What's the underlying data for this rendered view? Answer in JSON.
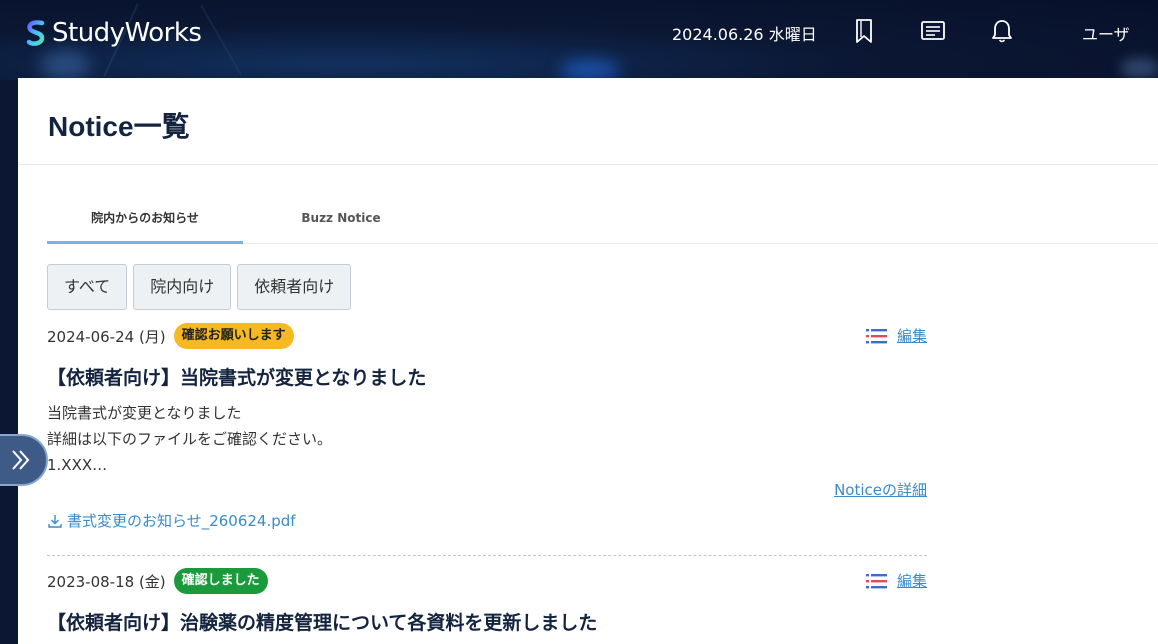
{
  "header": {
    "logo_text": "StudyWorks",
    "date": "2024.06.26 水曜日",
    "icons": [
      "bookmark-icon",
      "message-icon",
      "bell-icon"
    ],
    "user": "ユーザ"
  },
  "page": {
    "title": "Notice一覧"
  },
  "tabs": [
    {
      "label": "院内からのお知らせ",
      "active": true
    },
    {
      "label": "Buzz Notice",
      "active": false
    }
  ],
  "filters": [
    "すべて",
    "院内向け",
    "依頼者向け"
  ],
  "notices": [
    {
      "date": "2024-06-24 (月)",
      "badge": "確認お願いします",
      "badge_color": "#f6b921",
      "edit_label": "編集",
      "title": "【依頼者向け】当院書式が変更となりました",
      "body": [
        "当院書式が変更となりました",
        "詳細は以下のファイルをご確認ください。",
        "1.XXX…"
      ],
      "detail_link": "Noticeの詳細",
      "attachment": "書式変更のお知らせ_260624.pdf"
    },
    {
      "date": "2023-08-18 (金)",
      "badge": "確認しました",
      "badge_color": "#1a9a3a",
      "edit_label": "編集",
      "title": "【依頼者向け】治験薬の精度管理について各資料を更新しました"
    }
  ],
  "colors": {
    "header_bg": "#0b1733",
    "link": "#3a8bc8",
    "title": "#14243f",
    "tab_indicator": "#7fb0e6"
  }
}
